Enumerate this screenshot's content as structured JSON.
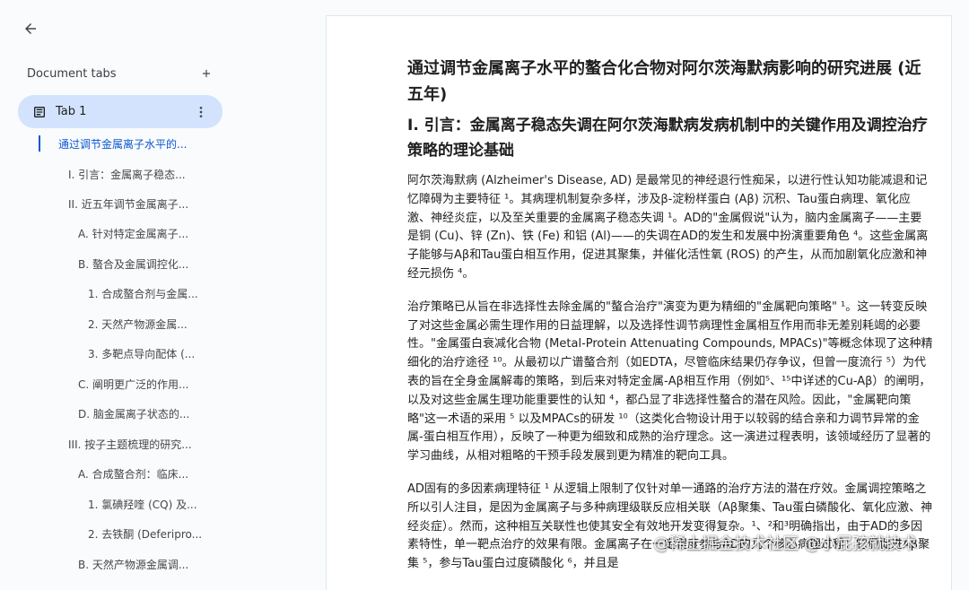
{
  "sidebar": {
    "tabs_title": "Document tabs",
    "tab_label": "Tab 1",
    "outline": [
      "通过调节金属离子水平的...",
      "I. 引言：金属离子稳态...",
      "II. 近五年调节金属离子...",
      "A. 针对特定金属离子...",
      "B. 螯合及金属调控化...",
      "1. 合成螯合剂与金属...",
      "2. 天然产物源金属...",
      "3. 多靶点导向配体 (...",
      "C. 阐明更广泛的作用...",
      "D. 脑金属离子状态的...",
      "III. 按子主题梳理的研究...",
      "A. 合成螯合剂：临床...",
      "1. 氯碘羟喹 (CQ) 及...",
      "2. 去铁酮 (Deferipro...",
      "B. 天然产物源金属调..."
    ]
  },
  "doc": {
    "title": "通过调节金属离子水平的螯合化合物对阿尔茨海默病影响的研究进展 (近五年)",
    "h1": "I. 引言：金属离子稳态失调在阿尔茨海默病发病机制中的关键作用及调控治疗策略的理论基础",
    "p1": "阿尔茨海默病 (Alzheimer's Disease, AD) 是最常见的神经退行性痴呆，以进行性认知功能减退和记忆障碍为主要特征 ¹。其病理机制复杂多样，涉及β-淀粉样蛋白 (Aβ) 沉积、Tau蛋白病理、氧化应激、神经炎症，以及至关重要的金属离子稳态失调 ¹。AD的\"金属假说\"认为，脑内金属离子——主要是铜 (Cu)、锌 (Zn)、铁 (Fe) 和铝 (Al)——的失调在AD的发生和发展中扮演重要角色 ⁴。这些金属离子能够与Aβ和Tau蛋白相互作用，促进其聚集，并催化活性氧 (ROS) 的产生，从而加剧氧化应激和神经元损伤 ⁴。",
    "p2": "治疗策略已从旨在非选择性去除金属的\"螯合治疗\"演变为更为精细的\"金属靶向策略\" ¹。这一转变反映了对这些金属必需生理作用的日益理解，以及选择性调节病理性金属相互作用而非无差别耗竭的必要性。\"金属蛋白衰减化合物 (Metal-Protein Attenuating Compounds, MPACs)\"等概念体现了这种精细化的治疗途径 ¹⁰。从最初以广谱螯合剂（如EDTA，尽管临床结果仍存争议，但曾一度流行 ⁵）为代表的旨在全身金属解毒的策略，到后来对特定金属-Aβ相互作用（例如⁵、¹⁵中详述的Cu-Aβ）的阐明，以及对这些金属生理功能重要性的认知 ⁴，都凸显了非选择性螯合的潜在风险。因此，\"金属靶向策略\"这一术语的采用 ⁵ 以及MPACs的研发 ¹⁰（这类化合物设计用于以较弱的结合亲和力调节异常的金属-蛋白相互作用），反映了一种更为细致和成熟的治疗理念。这一演进过程表明，该领域经历了显著的学习曲线，从相对粗略的干预手段发展到更为精准的靶向工具。",
    "p3": "AD固有的多因素病理特征 ¹ 从逻辑上限制了仅针对单一通路的治疗方法的潜在疗效。金属调控策略之所以引人注目，是因为金属离子与多种病理级联反应相关联（Aβ聚集、Tau蛋白磷酸化、氧化应激、神经炎症）。然而，这种相互关联性也使其安全有效地开发变得复杂。¹、²和³明确指出，由于AD的多因素特性，单一靶点治疗的效果有限。金属离子在一定程度参与AD的几个核心病理过程：它们促进Aβ聚集 ⁵，参与Tau蛋白过度磷酸化 ⁶，并且是"
  },
  "watermark": "@稀土掘金技术社区 @小屁孩就技术"
}
